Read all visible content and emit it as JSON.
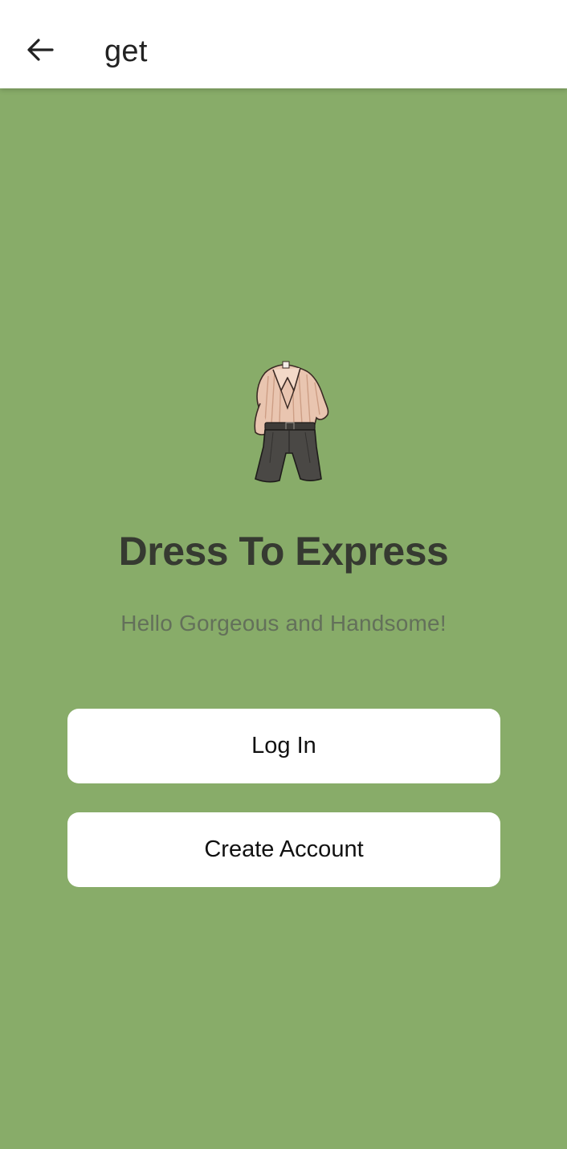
{
  "app_bar": {
    "title": "get",
    "back_icon": "arrow-left-icon"
  },
  "main": {
    "logo_icon": "outfit-illustration-icon",
    "headline": "Dress To Express",
    "subtitle": "Hello Gorgeous and Handsome!",
    "buttons": {
      "login_label": "Log In",
      "create_account_label": "Create Account"
    }
  },
  "colors": {
    "background": "#88ac69",
    "app_bar": "#ffffff",
    "button": "#ffffff",
    "headline_text": "#363a31",
    "subtitle_text": "#63705a"
  }
}
